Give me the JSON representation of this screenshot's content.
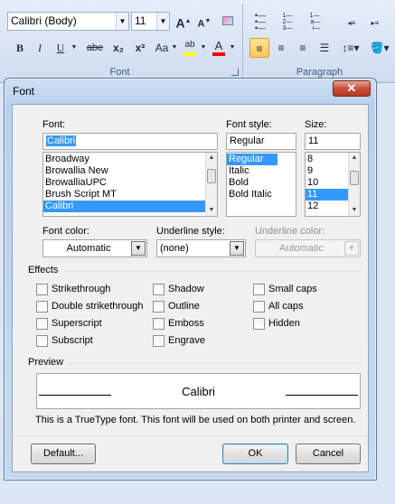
{
  "ribbon": {
    "font_name": "Calibri (Body)",
    "font_size": "11",
    "grow_font": "A",
    "shrink_font": "A",
    "bold": "B",
    "italic": "I",
    "underline": "U",
    "strikethrough": "abe",
    "subscript": "x₂",
    "superscript": "x²",
    "change_case": "Aa",
    "highlight": "ab",
    "font_color": "A",
    "group_font_label": "Font",
    "group_paragraph_label": "Paragraph"
  },
  "dialog": {
    "title": "Font",
    "close": "✕",
    "font_label": "Font:",
    "font_style_label": "Font style:",
    "size_label": "Size:",
    "font_value": "Calibri",
    "style_value": "Regular",
    "size_value": "11",
    "font_list": [
      "Broadway",
      "Browallia New",
      "BrowalliaUPC",
      "Brush Script MT",
      "Calibri"
    ],
    "style_list": [
      "Regular",
      "Italic",
      "Bold",
      "Bold Italic"
    ],
    "size_list": [
      "8",
      "9",
      "10",
      "11",
      "12"
    ],
    "font_color_label": "Font color:",
    "font_color_value": "Automatic",
    "underline_style_label": "Underline style:",
    "underline_style_value": "(none)",
    "underline_color_label": "Underline color:",
    "underline_color_value": "Automatic",
    "effects_label": "Effects",
    "effects": {
      "strikethrough": "Strikethrough",
      "double_strikethrough": "Double strikethrough",
      "superscript": "Superscript",
      "subscript": "Subscript",
      "shadow": "Shadow",
      "outline": "Outline",
      "emboss": "Emboss",
      "engrave": "Engrave",
      "small_caps": "Small caps",
      "all_caps": "All caps",
      "hidden": "Hidden"
    },
    "preview_label": "Preview",
    "preview_text": "Calibri",
    "note": "This is a TrueType font. This font will be used on both printer and screen.",
    "default_button": "Default...",
    "ok_button": "OK",
    "cancel_button": "Cancel"
  },
  "colors": {
    "selection": "#3399ff",
    "highlight_swatch": "#ffff00",
    "font_color_swatch": "#ff0000",
    "close_button": "#c9503a"
  }
}
